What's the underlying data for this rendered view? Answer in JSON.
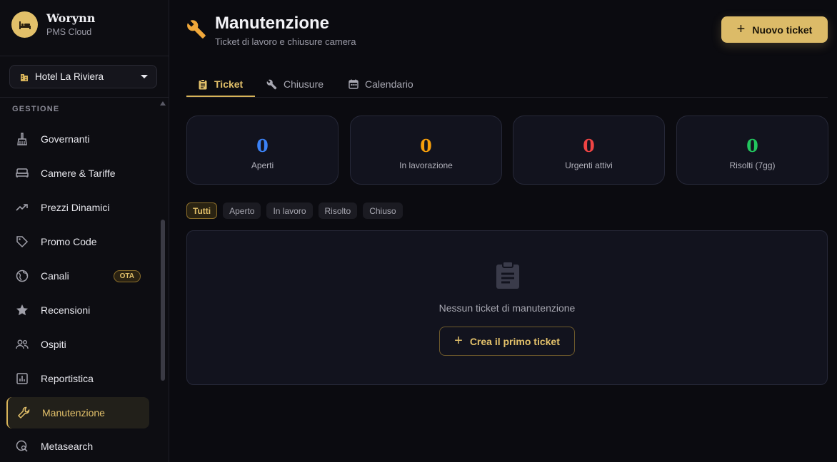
{
  "brand": {
    "name": "Worynn",
    "subtitle": "PMS Cloud",
    "logo_icon": "bed-icon"
  },
  "hotel_selector": {
    "value": "Hotel La Riviera",
    "icon": "building-icon"
  },
  "sidebar": {
    "section_title": "GESTIONE",
    "items": [
      {
        "label": "Governanti",
        "icon": "broom-icon"
      },
      {
        "label": "Camere & Tariffe",
        "icon": "bed-icon"
      },
      {
        "label": "Prezzi Dinamici",
        "icon": "trending-up-icon"
      },
      {
        "label": "Promo Code",
        "icon": "tag-icon"
      },
      {
        "label": "Canali",
        "icon": "globe-icon",
        "badge": "OTA"
      },
      {
        "label": "Recensioni",
        "icon": "star-icon"
      },
      {
        "label": "Ospiti",
        "icon": "people-icon"
      },
      {
        "label": "Reportistica",
        "icon": "bar-chart-icon"
      },
      {
        "label": "Manutenzione",
        "icon": "wrench-icon",
        "active": true
      },
      {
        "label": "Metasearch",
        "icon": "travel-explore-icon"
      }
    ]
  },
  "header": {
    "title": "Manutenzione",
    "subtitle": "Ticket di lavoro e chiusure camera",
    "new_button": "Nuovo ticket"
  },
  "tabs": [
    {
      "label": "Ticket",
      "icon": "clipboard-icon",
      "active": true
    },
    {
      "label": "Chiusure",
      "icon": "wrench-icon"
    },
    {
      "label": "Calendario",
      "icon": "calendar-icon"
    }
  ],
  "stats": [
    {
      "value": "0",
      "label": "Aperti",
      "color": "#3b82f6"
    },
    {
      "value": "0",
      "label": "In lavorazione",
      "color": "#f59e0b"
    },
    {
      "value": "0",
      "label": "Urgenti attivi",
      "color": "#ef4444"
    },
    {
      "value": "0",
      "label": "Risolti (7gg)",
      "color": "#22c55e"
    }
  ],
  "filters": [
    {
      "label": "Tutti",
      "active": true
    },
    {
      "label": "Aperto"
    },
    {
      "label": "In lavoro"
    },
    {
      "label": "Risolto"
    },
    {
      "label": "Chiuso"
    }
  ],
  "empty_state": {
    "icon": "clipboard-icon",
    "message": "Nessun ticket di manutenzione",
    "button": "Crea il primo ticket"
  },
  "colors": {
    "accent": "#dcbb68",
    "background": "#0b0b10",
    "panel": "#12131e"
  }
}
